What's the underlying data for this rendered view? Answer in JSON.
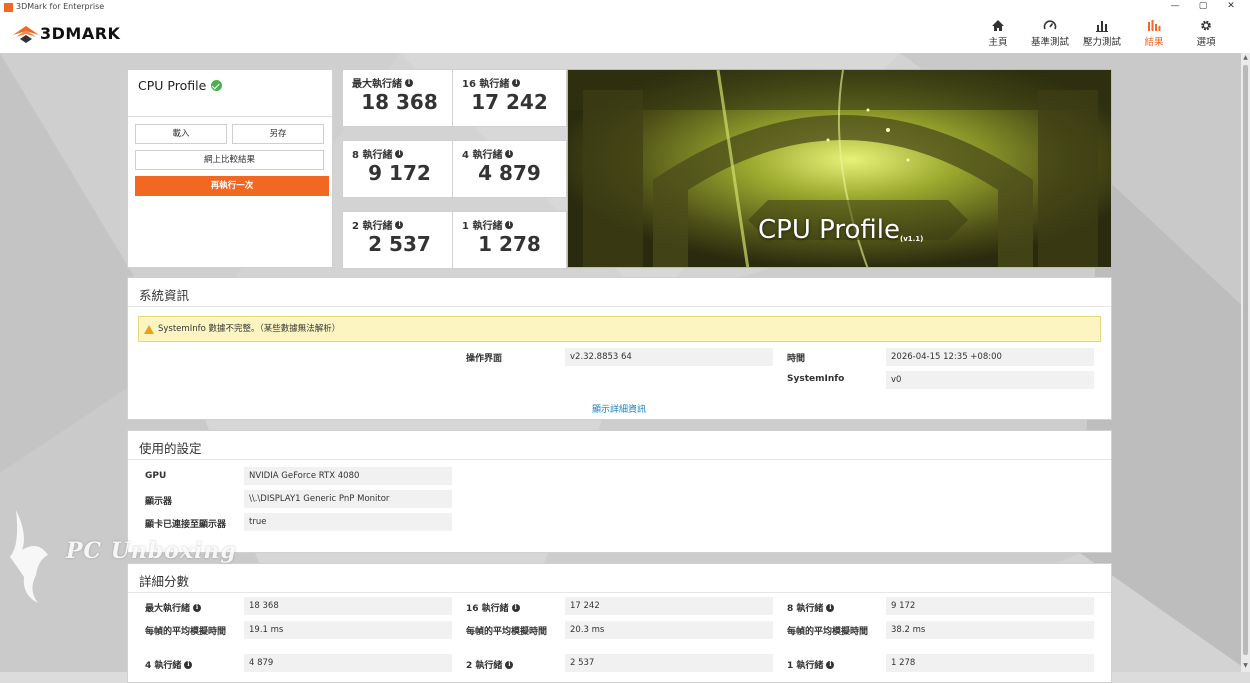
{
  "window": {
    "title": "3DMark for Enterprise",
    "minimize": "—",
    "maximize": "▢",
    "close": "✕"
  },
  "brand": {
    "name": "3DMARK"
  },
  "nav": [
    {
      "label": "主頁",
      "icon": "home-icon"
    },
    {
      "label": "基準測試",
      "icon": "gauge-icon"
    },
    {
      "label": "壓力測試",
      "icon": "stress-chart-icon"
    },
    {
      "label": "結果",
      "icon": "results-chart-icon",
      "active": true
    },
    {
      "label": "選項",
      "icon": "gear-icon"
    }
  ],
  "profile": {
    "title": "CPU Profile",
    "load": "載入",
    "save": "另存",
    "compare_online": "網上比較結果",
    "run_again": "再執行一次"
  },
  "scores": [
    {
      "label": "最大執行緒",
      "value": "18 368"
    },
    {
      "label": "16 執行緒",
      "value": "17 242"
    },
    {
      "label": "8 執行緒",
      "value": "9 172"
    },
    {
      "label": "4 執行緒",
      "value": "4 879"
    },
    {
      "label": "2 執行緒",
      "value": "2 537"
    },
    {
      "label": "1 執行緒",
      "value": "1 278"
    }
  ],
  "hero": {
    "title": "CPU Profile",
    "version": "(v1.1)"
  },
  "system_info": {
    "title": "系統資訊",
    "warning": "SystemInfo 數據不完整。（某些數據無法解析）",
    "os_label": "操作界面",
    "os_value": "v2.32.8853 64",
    "time_label": "時間",
    "time_value": "2026-04-15 12:35 +08:00",
    "sysinfo_label": "SystemInfo",
    "sysinfo_value": "v0",
    "show_details": "顯示詳細資訊"
  },
  "settings": {
    "title": "使用的設定",
    "rows": [
      {
        "label": "GPU",
        "value": "NVIDIA GeForce RTX 4080"
      },
      {
        "label": "顯示器",
        "value": "\\\\.\\DISPLAY1 Generic PnP Monitor"
      },
      {
        "label": "顯卡已連接至顯示器",
        "value": "true"
      }
    ]
  },
  "detailed": {
    "title": "詳細分數",
    "avg_label": "每幀的平均模擬時間",
    "items": [
      {
        "label": "最大執行緒",
        "score": "18 368",
        "avg": "19.1 ms"
      },
      {
        "label": "16 執行緒",
        "score": "17 242",
        "avg": "20.3 ms"
      },
      {
        "label": "8 執行緒",
        "score": "9 172",
        "avg": "38.2 ms"
      },
      {
        "label": "4 執行緒",
        "score": "4 879"
      },
      {
        "label": "2 執行緒",
        "score": "2 537"
      },
      {
        "label": "1 執行緒",
        "score": "1 278"
      }
    ]
  },
  "watermark": {
    "text": "PC Unboxing"
  }
}
